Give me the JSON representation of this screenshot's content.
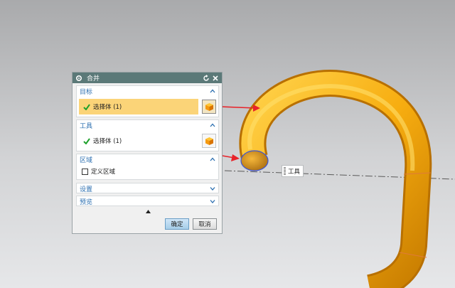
{
  "dialog": {
    "title": "合并",
    "groups": {
      "target": {
        "label": "目标",
        "row_label": "选择体 (1)"
      },
      "tool": {
        "label": "工具",
        "row_label": "选择体 (1)"
      },
      "region": {
        "label": "区域",
        "checkbox_label": "定义区域",
        "checked": false
      },
      "settings": {
        "label": "设置"
      },
      "preview": {
        "label": "预览"
      }
    },
    "buttons": {
      "ok": "确定",
      "cancel": "取消"
    }
  },
  "viewport": {
    "tool_tag": "工具",
    "colors": {
      "pipe": "#f7ad10",
      "arrow": "#e8232a",
      "highlight": "#fbd478",
      "titlebar": "#5b7978"
    }
  }
}
